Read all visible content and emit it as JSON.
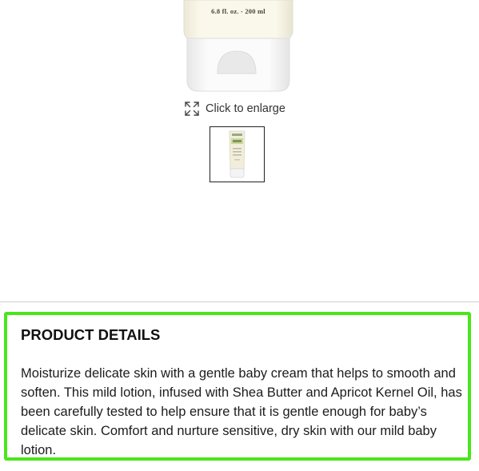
{
  "product": {
    "size_label": "6.8 fl. oz. - 200 ml"
  },
  "gallery": {
    "enlarge_label": "Click to enlarge",
    "enlarge_icon": "expand-icon"
  },
  "details": {
    "title": "PRODUCT DETAILS",
    "description": "Moisturize delicate skin with a gentle baby cream that helps to smooth and soften. This mild lotion, infused with Shea Butter and Apricot Kernel Oil, has been carefully tested to help ensure that it is gentle enough for baby’s delicate skin. Comfort and nurture sensitive, dry skin with our mild baby lotion.",
    "highlight_color": "#4ae61a"
  }
}
